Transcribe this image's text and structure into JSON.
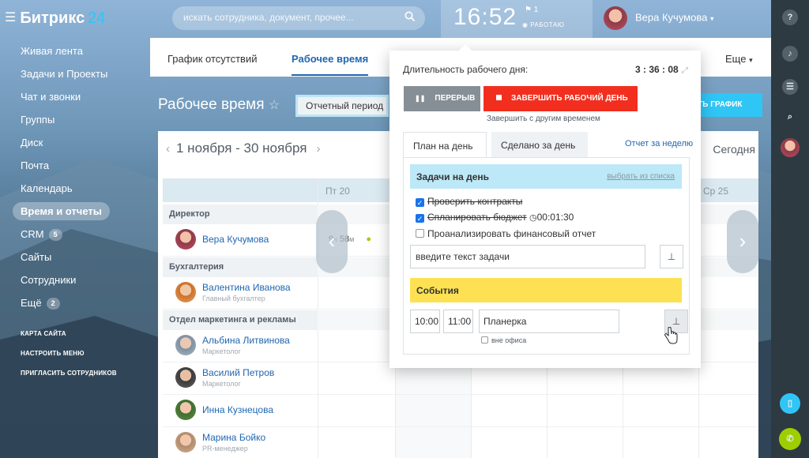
{
  "app": {
    "brand": "Битрикс",
    "brand_num": "24"
  },
  "search": {
    "placeholder": "искать сотрудника, документ, прочее..."
  },
  "clock": {
    "time": "16:52",
    "flag_count": "1",
    "status": "РАБОТАЮ"
  },
  "user": {
    "name": "Вера Кучумова"
  },
  "sidebar": {
    "items": [
      {
        "label": "Живая лента"
      },
      {
        "label": "Задачи и Проекты"
      },
      {
        "label": "Чат и звонки"
      },
      {
        "label": "Группы"
      },
      {
        "label": "Диск"
      },
      {
        "label": "Почта"
      },
      {
        "label": "Календарь"
      },
      {
        "label": "Время и отчеты"
      },
      {
        "label": "CRM",
        "count": "5"
      },
      {
        "label": "Сайты"
      },
      {
        "label": "Сотрудники"
      },
      {
        "label": "Ещё",
        "count": "2"
      }
    ],
    "links": [
      "КАРТА САЙТА",
      "НАСТРОИТЬ МЕНЮ",
      "ПРИГЛАСИТЬ СОТРУДНИКОВ"
    ]
  },
  "tabs": {
    "absence": "График отсутствий",
    "worktime": "Рабочее время",
    "more": "Еще"
  },
  "page": {
    "title": "Рабочее время",
    "period_label": "Отчетный период п",
    "add_button": "ИТЬ ГРАФИК",
    "range": "1 ноября - 30 ноября",
    "today": "Сегодня"
  },
  "grid": {
    "days": [
      "Пт 20",
      "Ср 25"
    ],
    "sections": [
      "Директор",
      "Бухгалтерия",
      "Отдел маркетинга и рекламы"
    ],
    "people": [
      {
        "name": "Вера Кучумова",
        "role": ""
      },
      {
        "name": "Валентина Иванова",
        "role": "Главный бухгалтер"
      },
      {
        "name": "Альбина Литвинова",
        "role": "Маркетолог"
      },
      {
        "name": "Василий Петров",
        "role": "Маркетолог"
      },
      {
        "name": "Инна Кузнецова",
        "role": ""
      },
      {
        "name": "Марина Бойко",
        "role": "PR-менеджер"
      }
    ],
    "worklog": {
      "hours": "9",
      "h_unit": "ч",
      "minutes": "58",
      "m_unit": "м"
    }
  },
  "popup": {
    "duration_label": "Длительность рабочего дня:",
    "duration_value": "3 : 36 : 08",
    "pause_button": "ПЕРЕРЫВ",
    "end_button": "ЗАВЕРШИТЬ РАБОЧИЙ ДЕНЬ",
    "end_other": "Завершить с другим временем",
    "tab_plan": "План на день",
    "tab_done": "Сделано за день",
    "week_report": "Отчет за неделю",
    "tasks_header": "Задачи на день",
    "choose_from_list": "выбрать из списка",
    "tasks": [
      {
        "text": "Проверить контракты",
        "done": true,
        "time": ""
      },
      {
        "text": "Спланировать бюджет",
        "done": true,
        "time": "00:01:30"
      },
      {
        "text": "Проанализировать финансовый отчет",
        "done": false,
        "time": ""
      }
    ],
    "task_input_value": "введите текст задачи",
    "events_header": "События",
    "event": {
      "from": "10:00",
      "to": "11:00",
      "name": "Планерка",
      "out_of_office": "вне офиса"
    }
  },
  "colors": {
    "accent": "#2fc6f6",
    "link": "#2067b0",
    "danger": "#f22f1f",
    "events": "#fde152",
    "tasks": "#bde8f7"
  }
}
